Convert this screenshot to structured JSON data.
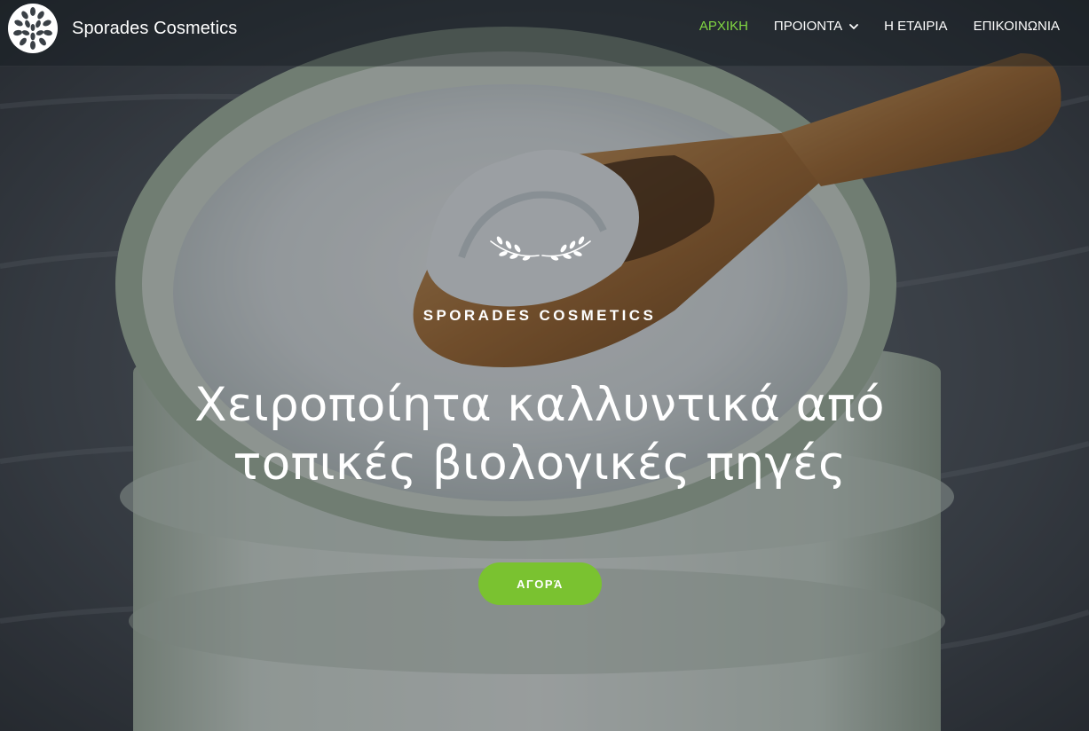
{
  "brand": {
    "name": "Sporades Cosmetics",
    "logo_icon": "leaf-circle-logo-icon"
  },
  "nav": {
    "items": [
      {
        "label": "ΑΡΧΙΚΗ",
        "active": true
      },
      {
        "label": "ΠΡΟΙΟΝΤΑ",
        "has_dropdown": true
      },
      {
        "label": "Η ΕΤΑΙΡΙΑ"
      },
      {
        "label": "ΕΠΙΚΟΙΝΩΝΙΑ"
      }
    ],
    "dropdown_icon": "chevron-down-icon"
  },
  "hero": {
    "ornament_icon": "laurel-branch-icon",
    "tagline": "SPORADES COSMETICS",
    "headline_line1": "Χειροποίητα καλλυντικά από",
    "headline_line2": "τοπικές βιολογικές πηγές",
    "cta_label": "ΑΓΟΡΆ"
  },
  "colors": {
    "accent": "#81d742",
    "button": "#7ac230",
    "text": "#ffffff"
  }
}
